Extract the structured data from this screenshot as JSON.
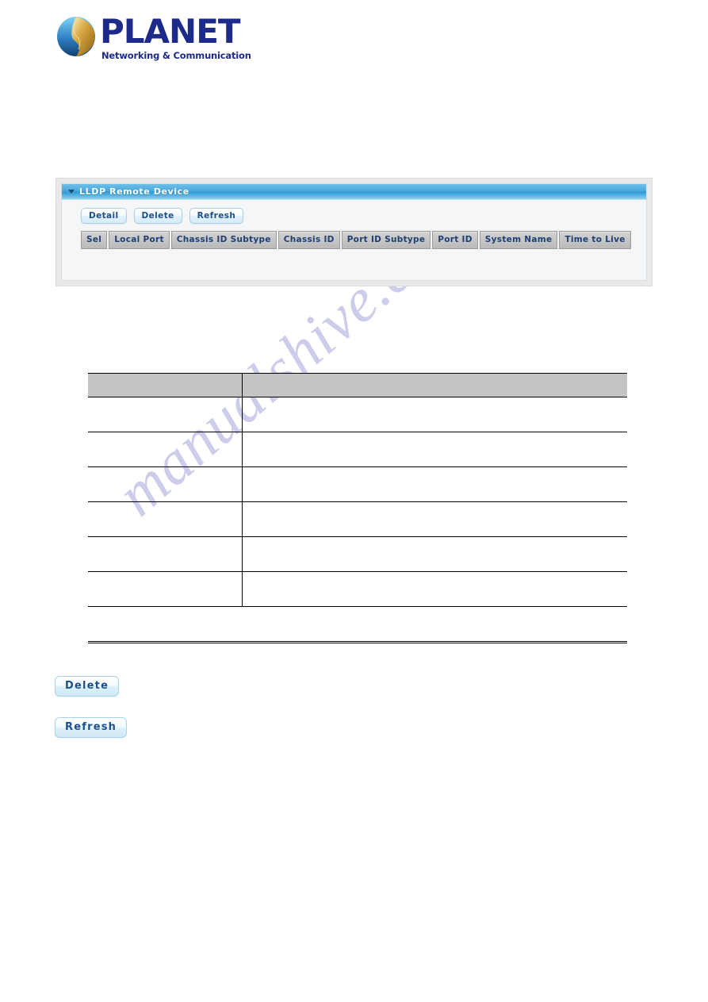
{
  "page": {
    "watermark": "manualshive.com",
    "background": "#ffffff"
  },
  "logo": {
    "brand": "PLANET",
    "tagline": "Networking & Communication",
    "brand_color": "#1c2a8a"
  },
  "panel": {
    "title": "LLDP Remote Device",
    "header_color": "#4daadd",
    "collapse_icon": "triangle-down-icon",
    "buttons": [
      {
        "label": "Detail"
      },
      {
        "label": "Delete"
      },
      {
        "label": "Refresh"
      }
    ],
    "table": {
      "columns": [
        "Sel",
        "Local Port",
        "Chassis ID Subtype",
        "Chassis ID",
        "Port ID Subtype",
        "Port ID",
        "System Name",
        "Time to Live"
      ],
      "rows": []
    }
  },
  "description_table": {
    "header": [
      "",
      ""
    ],
    "header_bg": "#c4c4c4",
    "rows": [
      [
        "",
        ""
      ],
      [
        "",
        ""
      ],
      [
        "",
        ""
      ],
      [
        "",
        ""
      ],
      [
        "",
        ""
      ],
      [
        "",
        ""
      ],
      [
        "",
        ""
      ]
    ]
  },
  "bottom_buttons": [
    {
      "label": "Delete"
    },
    {
      "label": "Refresh"
    }
  ]
}
